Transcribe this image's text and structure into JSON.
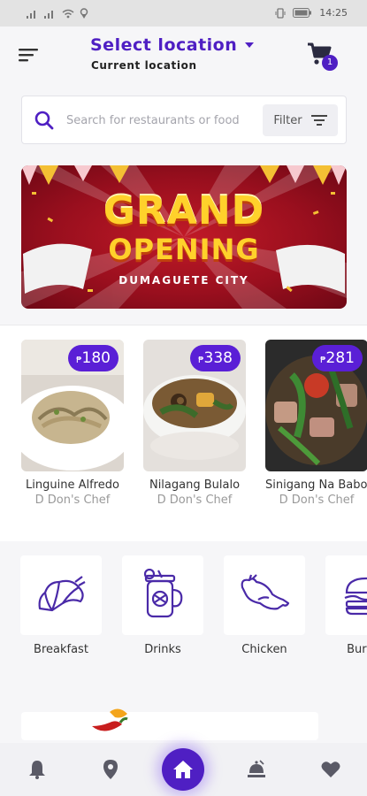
{
  "status_bar": {
    "time": "14:25"
  },
  "header": {
    "location_title": "Select location",
    "location_subtitle": "Current location",
    "cart_count": "1"
  },
  "search": {
    "placeholder": "Search for restaurants or food",
    "filter_label": "Filter"
  },
  "banner": {
    "title_line1": "GRAND",
    "title_line2": "OPENING",
    "subtitle": "DUMAGUETE CITY",
    "colors": {
      "background": "#a8121f",
      "text": "#ffd12b"
    }
  },
  "foods": [
    {
      "currency": "₱",
      "price": "180",
      "name": "Linguine Alfredo",
      "chef": "D Don's Chef"
    },
    {
      "currency": "₱",
      "price": "338",
      "name": "Nilagang Bulalo",
      "chef": "D Don's Chef"
    },
    {
      "currency": "₱",
      "price": "281",
      "name": "Sinigang  Na Baboy",
      "chef": "D Don's Chef"
    }
  ],
  "categories": [
    {
      "label": "Breakfast",
      "icon": "croissant-icon"
    },
    {
      "label": "Drinks",
      "icon": "drink-jar-icon"
    },
    {
      "label": "Chicken",
      "icon": "chicken-icon"
    },
    {
      "label": "Burger",
      "icon": "burger-icon"
    }
  ],
  "bottom_nav": {
    "items": [
      "bell-icon",
      "location-pin-icon",
      "home-icon",
      "dish-icon",
      "heart-icon"
    ],
    "active": "home-icon"
  },
  "theme": {
    "accent": "#4f1fc3",
    "badge": "#5a1fd6"
  }
}
